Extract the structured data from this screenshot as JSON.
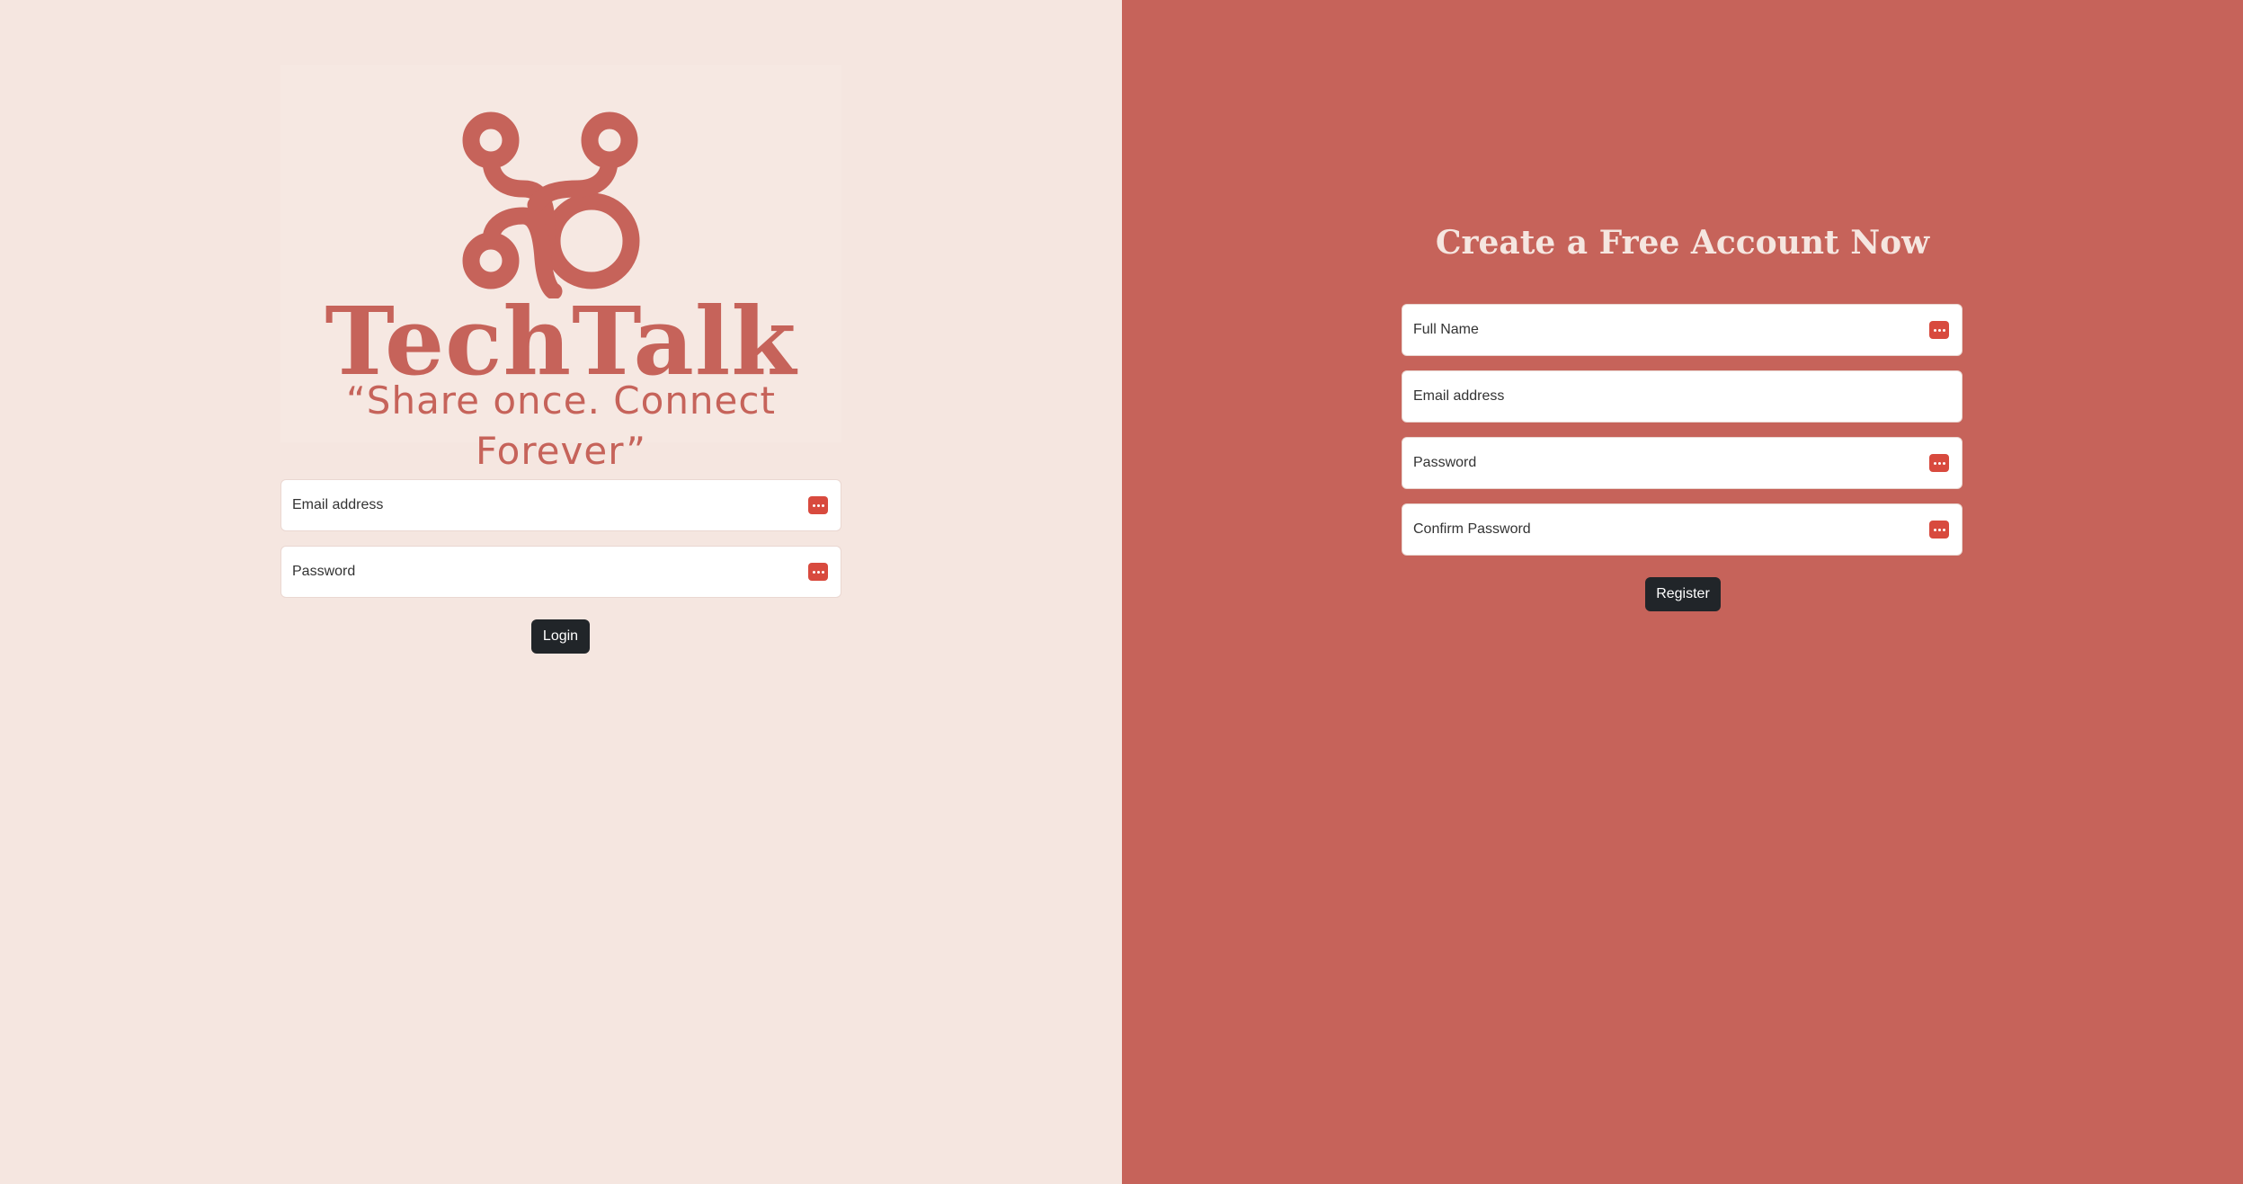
{
  "colors": {
    "left_background": "#f5e6e0",
    "right_background": "#c6635a",
    "brand": "#c6635a",
    "button": "#212529",
    "field_icon": "#d84a3e"
  },
  "login": {
    "brand_name": "TechTalk",
    "tagline": "“Share once. Connect Forever”",
    "logo_icon": "techtalk-logo-icon",
    "email_placeholder": "Email address",
    "password_placeholder": "Password",
    "password_icon": "password-manager-icon",
    "login_label": "Login"
  },
  "register": {
    "title": "Create a Free Account Now",
    "fullname_placeholder": "Full Name",
    "email_placeholder": "Email address",
    "password_placeholder": "Password",
    "confirm_password_placeholder": "Confirm Password",
    "field_icon": "password-manager-icon",
    "register_label": "Register"
  }
}
